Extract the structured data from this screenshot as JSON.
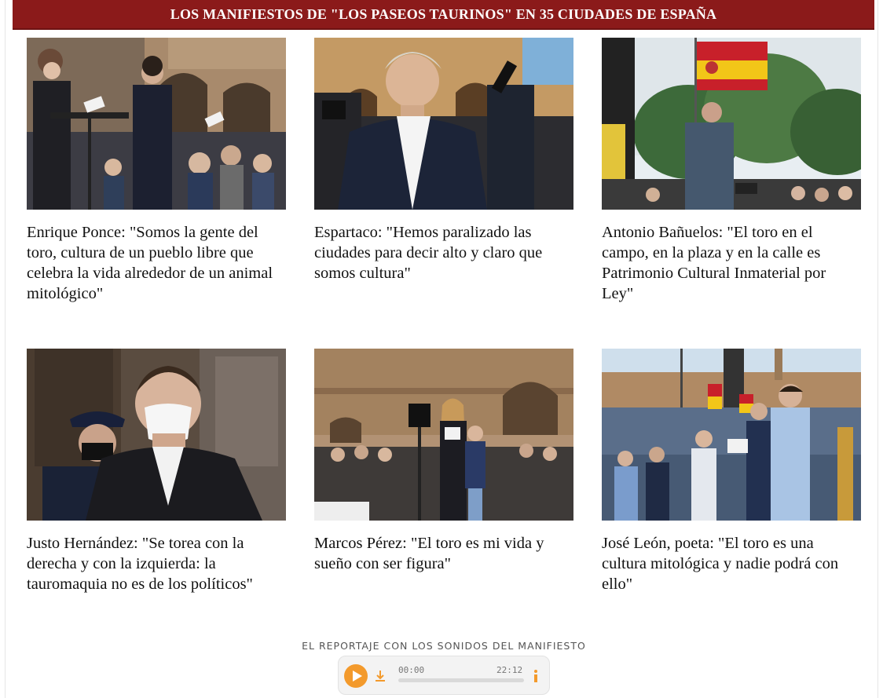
{
  "header": {
    "title": "LOS MANIFIESTOS DE \"LOS PASEOS TAURINOS\" EN 35 CIUDADES DE ESPAÑA"
  },
  "articles": [
    {
      "caption": "Enrique Ponce: \"Somos la gente del toro, cultura de un pueblo libre que celebra la vida alrededor de un animal mitológico\""
    },
    {
      "caption": "Espartaco: \"Hemos paralizado las ciudades para decir alto y claro que somos cultura\""
    },
    {
      "caption": "Antonio Bañuelos: \"El toro en el campo, en la plaza y en la calle es Patrimonio Cultural Inmaterial por Ley\""
    },
    {
      "caption": "Justo Hernández: \"Se torea con la derecha y con la izquierda: la tauromaquia no es de los políticos\""
    },
    {
      "caption": "Marcos Pérez: \"El toro es mi vida y sueño con ser figura\""
    },
    {
      "caption": "José León, poeta: \"El toro es una cultura mitológica y nadie podrá con ello\""
    }
  ],
  "audio": {
    "label": "EL REPORTAJE CON LOS SONIDOS DEL MANIFIESTO",
    "current_time": "00:00",
    "duration": "22:12",
    "progress": 0,
    "icons": [
      "play-icon",
      "download-icon",
      "info-icon"
    ]
  },
  "colors": {
    "header_bg": "#8b1a1a",
    "player_accent": "#f39a2c"
  }
}
